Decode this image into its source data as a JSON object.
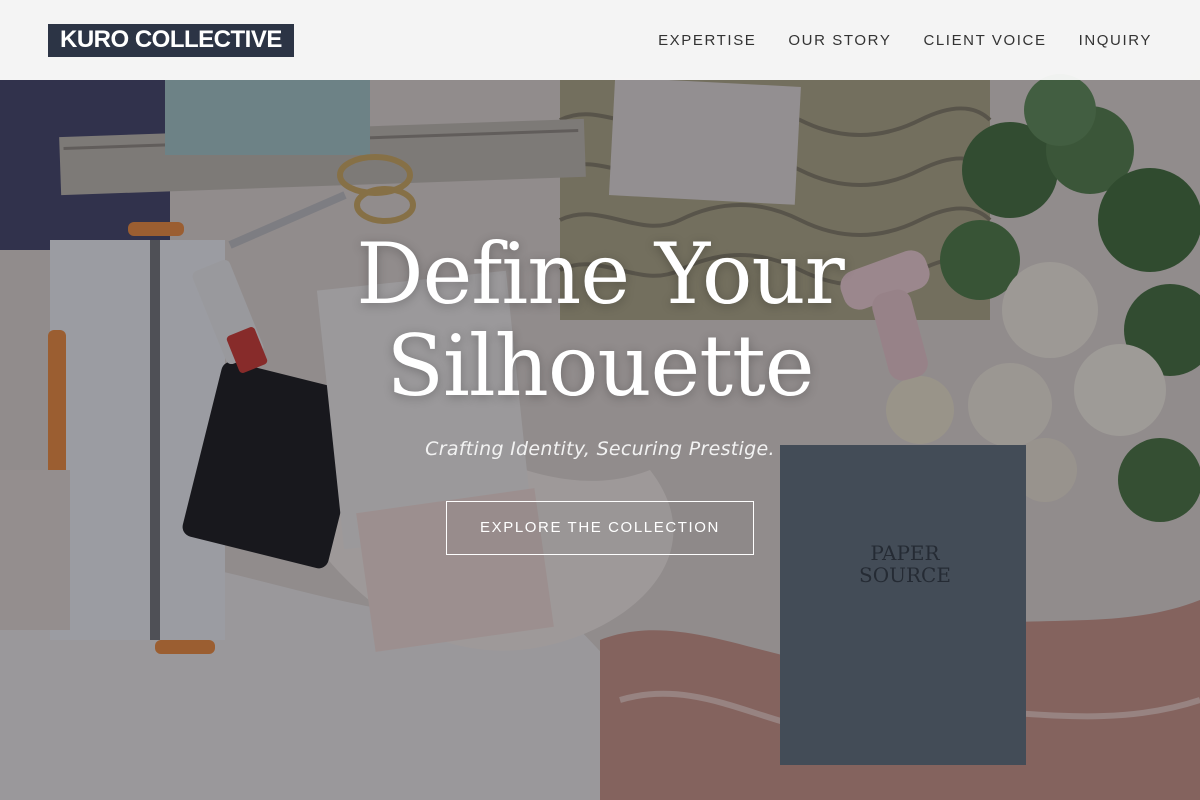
{
  "header": {
    "logo": "KURO COLLECTIVE",
    "nav": [
      {
        "label": "EXPERTISE"
      },
      {
        "label": "OUR STORY"
      },
      {
        "label": "CLIENT VOICE"
      },
      {
        "label": "INQUIRY"
      }
    ]
  },
  "hero": {
    "title_line1": "Define Your",
    "title_line2": "Silhouette",
    "subtitle": "Crafting Identity, Securing Prestige.",
    "cta_label": "EXPLORE THE COLLECTION"
  },
  "colors": {
    "logo_bg": "#2c3445",
    "header_bg": "#fafafa",
    "hero_text": "#ffffff"
  }
}
